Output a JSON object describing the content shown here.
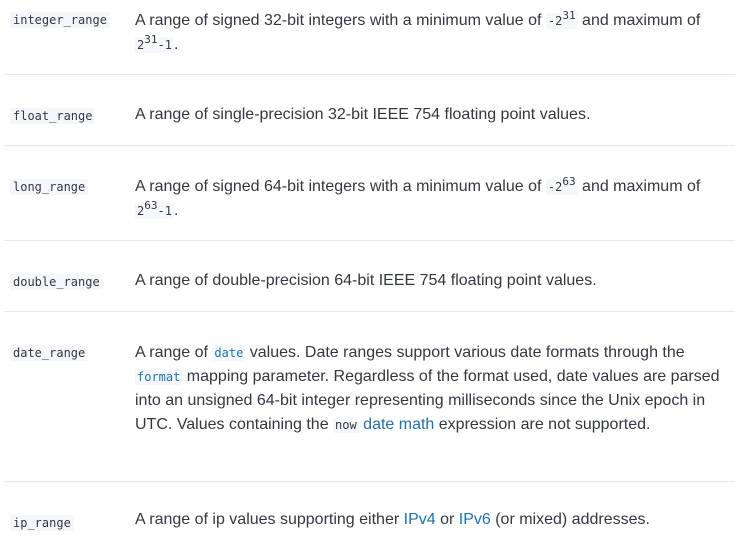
{
  "rows": [
    {
      "type": "integer_range",
      "d1": "A range of signed 32-bit integers with a minimum value of ",
      "neg_base": "-2",
      "exp": "31",
      "d2": " and maximum of ",
      "pos_base": "2",
      "exp2": "31",
      "tail": "-1",
      "end": "."
    },
    {
      "type": "float_range",
      "desc": "A range of single-precision 32-bit IEEE 754 floating point values."
    },
    {
      "type": "long_range",
      "d1": "A range of signed 64-bit integers with a minimum value of ",
      "neg_base": "-2",
      "exp": "63",
      "d2": " and maximum of ",
      "pos_base": "2",
      "exp2": "63",
      "tail": "-1",
      "end": "."
    },
    {
      "type": "double_range",
      "desc": "A range of double-precision 64-bit IEEE 754 floating point values."
    },
    {
      "type": "date_range",
      "p1": "A range of ",
      "code_date": "date",
      "p2": " values. Date ranges support various date formats through the ",
      "code_format": "format",
      "p3": " mapping parameter. Regardless of the format used, date values are parsed into an unsigned 64-bit integer representing milliseconds since the Unix epoch in UTC. Values containing the ",
      "code_now": "now",
      "p4": " ",
      "link_datemath": "date math",
      "p5": " expression are not supported."
    },
    {
      "type": "ip_range",
      "p1": "A range of ip values supporting either ",
      "link_ipv4": "IPv4",
      "p2": " or ",
      "link_ipv6": "IPv6",
      "p3": " (or mixed) addresses."
    }
  ],
  "colors": {
    "link": "#1a73b5",
    "text": "#343741",
    "divider": "#e6e9ee",
    "code_bg": "#f5f7fa"
  }
}
